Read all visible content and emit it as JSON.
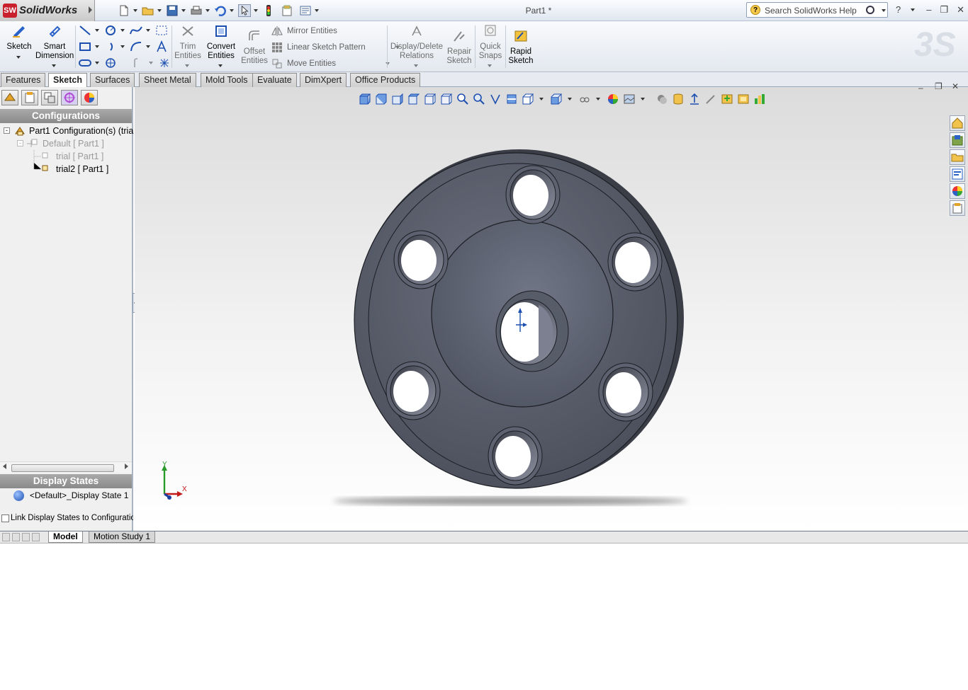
{
  "app": {
    "name": "SolidWorks",
    "logo_text": "SW",
    "document_title": "Part1 *"
  },
  "search": {
    "placeholder": "Search SolidWorks Help"
  },
  "quick_access": [
    "new-icon",
    "open-icon",
    "save-icon",
    "print-icon",
    "undo-icon",
    "select-icon",
    "rebuild-icon",
    "file-properties-icon",
    "options-icon"
  ],
  "command_manager": {
    "sketch": "Sketch",
    "smart_dimension_1": "Smart",
    "smart_dimension_2": "Dimension",
    "trim_1": "Trim",
    "trim_2": "Entities",
    "convert_1": "Convert",
    "convert_2": "Entities",
    "offset_1": "Offset",
    "offset_2": "Entities",
    "mirror": "Mirror Entities",
    "linear_pattern": "Linear Sketch Pattern",
    "move": "Move Entities",
    "display_delete_1": "Display/Delete",
    "display_delete_2": "Relations",
    "repair_1": "Repair",
    "repair_2": "Sketch",
    "quick_snaps_1": "Quick",
    "quick_snaps_2": "Snaps",
    "rapid_1": "Rapid",
    "rapid_2": "Sketch"
  },
  "tabs": [
    "Features",
    "Sketch",
    "Surfaces",
    "Sheet Metal",
    "Mold Tools",
    "Evaluate",
    "DimXpert",
    "Office Products"
  ],
  "active_tab": "Sketch",
  "config_panel": {
    "header": "Configurations",
    "root": "Part1 Configuration(s)  (tria",
    "items": [
      {
        "label": "Default [ Part1 ]",
        "state": "inactive"
      },
      {
        "label": "trial [ Part1 ]",
        "state": "inactive"
      },
      {
        "label": "trial2 [ Part1 ]",
        "state": "active"
      }
    ]
  },
  "display_states": {
    "header": "Display States",
    "item": "<Default>_Display State 1",
    "link_checkbox_label": "Link Display States to Configuration",
    "link_checked": false
  },
  "triad": {
    "x_label": "X",
    "y_label": "Y"
  },
  "bottom_tabs": [
    "Model",
    "Motion Study 1"
  ],
  "active_bottom_tab": "Model",
  "colors": {
    "part_face": "#585d6a",
    "part_edge": "#1c1e24",
    "accent_red": "#c8202c",
    "panel_header": "#9a9a9a"
  }
}
